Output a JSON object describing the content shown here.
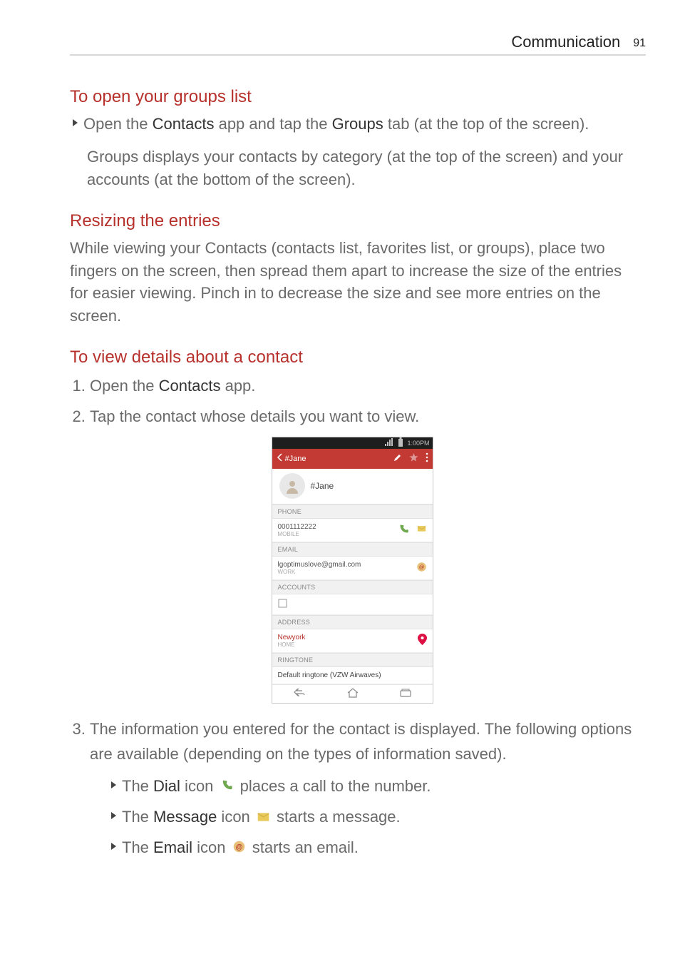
{
  "header": {
    "section": "Communication",
    "page": "91"
  },
  "s1": {
    "heading": "To open your groups list",
    "bullet_a": "Open the ",
    "bullet_b": "Contacts",
    "bullet_c": " app and tap the ",
    "bullet_d": "Groups",
    "bullet_e": " tab (at the top of the screen).",
    "para": "Groups displays your contacts by category (at the top of the screen) and your accounts (at the bottom of the screen)."
  },
  "s2": {
    "heading": "Resizing the entries",
    "para": "While viewing your Contacts (contacts list, favorites list, or groups), place two fingers on the screen, then spread them apart to increase the size of the entries for easier viewing. Pinch in to decrease the size and see more entries on the screen."
  },
  "s3": {
    "heading": "To view details about a contact",
    "step1_a": "Open the ",
    "step1_b": "Contacts",
    "step1_c": " app.",
    "step2": "Tap the contact whose details you want to view.",
    "step3": "The information you entered for the contact is displayed. The following options are available (depending on the types of information saved).",
    "b1_a": "The ",
    "b1_b": "Dial",
    "b1_c": " icon ",
    "b1_d": " places a call to the number.",
    "b2_a": "The ",
    "b2_b": "Message",
    "b2_c": " icon ",
    "b2_d": " starts a message.",
    "b3_a": "The ",
    "b3_b": "Email",
    "b3_c": " icon ",
    "b3_d": " starts an email."
  },
  "phone": {
    "status_time": "1:00PM",
    "title": "#Jane",
    "hero_name": "#Jane",
    "sec_phone": "PHONE",
    "phone_value": "0001112222",
    "phone_label": "MOBILE",
    "sec_email": "EMAIL",
    "email_value": "lgoptimuslove@gmail.com",
    "email_label": "WORK",
    "sec_accounts": "ACCOUNTS",
    "sec_address": "ADDRESS",
    "address_value": "Newyork",
    "address_label": "HOME",
    "sec_ringtone": "RINGTONE",
    "ringtone_value": "Default ringtone (VZW Airwaves)"
  },
  "chart_data": {
    "type": "table",
    "note": "document page, no chart"
  }
}
